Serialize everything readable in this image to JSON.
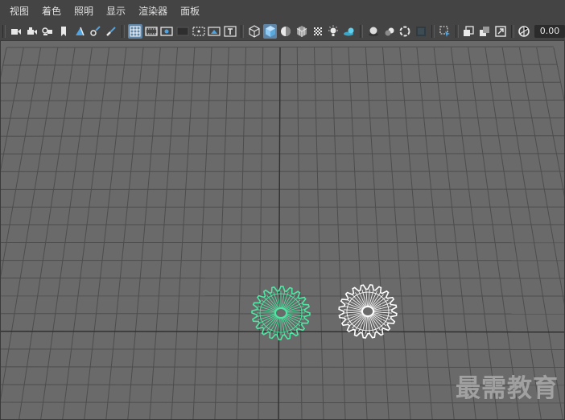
{
  "menubar": {
    "items": [
      "视图",
      "着色",
      "照明",
      "显示",
      "渲染器",
      "面板"
    ]
  },
  "toolbar": {
    "exposure_value": "0.00",
    "accent_color": "#5d86a8",
    "icon_groups": [
      [
        "camera-select-icon",
        "camera-attributes-icon",
        "bookmark-icon",
        "image-plane-icon"
      ],
      [
        "2d-pan-zoom-icon",
        "grease-pencil-icon",
        "paint-icon"
      ],
      [
        "grid-icon",
        "film-gate-icon",
        "resolution-gate-icon",
        "gate-mask-icon",
        "field-chart-icon",
        "safe-action-icon",
        "safe-title-icon"
      ],
      [
        "wireframe-icon",
        "smooth-shade-all-icon",
        "use-default-material-icon",
        "wireframe-on-shaded-icon",
        "xray-icon",
        "use-all-lights-icon",
        "shadows-icon"
      ],
      [
        "screen-space-ambient-occlusion-icon",
        "motion-blur-icon",
        "multisample-antialiasing-icon",
        "depth-of-field-icon"
      ],
      [
        "isolate-select-icon"
      ],
      [
        "xray-joints-icon",
        "xray-active-components-icon",
        "heads-up-display-icon"
      ],
      [
        "exposure-icon"
      ]
    ]
  },
  "viewport": {
    "background_color": "#6a6a6a",
    "grid_line_color": "#4d4d4d",
    "axis_line_color": "#303030",
    "selected_gear_color": "#4ee8a4",
    "unselected_gear_color": "#ffffff"
  },
  "watermark": {
    "text": "最需教育"
  }
}
